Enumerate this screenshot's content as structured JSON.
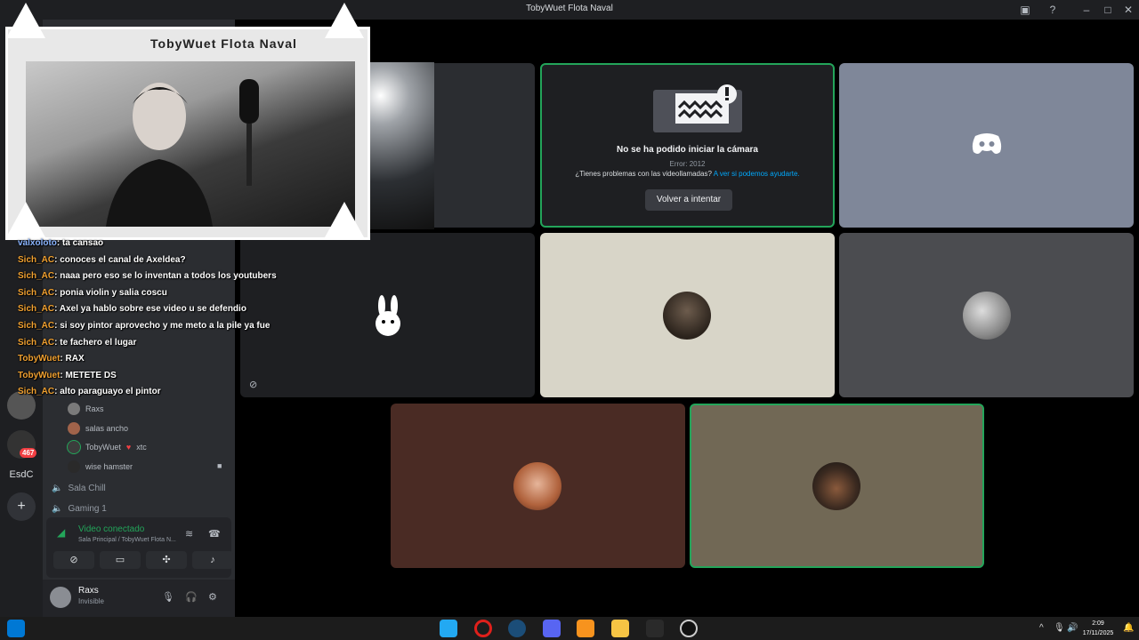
{
  "window": {
    "title": "TobyWuet Flota Naval"
  },
  "titlebar_icons": [
    "inbox-icon",
    "help-icon",
    "minimize-icon",
    "maximize-icon",
    "close-icon"
  ],
  "cam_overlay": {
    "title_text": "TobyWuet Flota Naval"
  },
  "chat": [
    {
      "nick": "valxoloto",
      "msg": ": ta cansao",
      "color": "blue"
    },
    {
      "nick": "Sich_AC",
      "msg": ": conoces el canal de Axeldea?",
      "color": "orange"
    },
    {
      "nick": "Sich_AC",
      "msg": ": naaa pero eso se lo inventan a todos los youtubers",
      "color": "orange"
    },
    {
      "nick": "Sich_AC",
      "msg": ": ponia violin y salia coscu",
      "color": "orange"
    },
    {
      "nick": "Sich_AC",
      "msg": ": Axel ya hablo sobre ese video u se defendio",
      "color": "orange"
    },
    {
      "nick": "Sich_AC",
      "msg": ": si soy pintor aprovecho y me meto a la pile ya fue",
      "color": "orange"
    },
    {
      "nick": "Sich_AC",
      "msg": ": te fachero el lugar",
      "color": "orange"
    },
    {
      "nick": "TobyWuet",
      "msg": ": RAX",
      "color": "orange"
    },
    {
      "nick": "TobyWuet",
      "msg": ": METETE DS",
      "color": "orange"
    },
    {
      "nick": "Sich_AC",
      "msg": ": alto paraguayo el pintor",
      "color": "orange"
    }
  ],
  "sidebar": {
    "members": [
      {
        "name": "Raxs",
        "extra": ""
      },
      {
        "name": "salas ancho",
        "extra": ""
      },
      {
        "name": "TobyWuet",
        "extra": "xtc"
      },
      {
        "name": "wise hamster",
        "extra": ""
      }
    ],
    "channels": [
      {
        "name": "Sala Chill"
      },
      {
        "name": "Gaming 1"
      }
    ],
    "server_label": "EsdC",
    "badge": "467"
  },
  "voice": {
    "status": "Video conectado",
    "location": "Sala Principal / TobyWuet Flota N..."
  },
  "user": {
    "name": "Raxs",
    "status": "Invisible"
  },
  "camera_error": {
    "title": "No se ha podido iniciar la cámara",
    "code": "Error: 2012",
    "help_text": "¿Tienes problemas con las videollamadas?",
    "help_link": "A ver si podemos ayudarte.",
    "retry": "Volver a intentar"
  },
  "tiles_colors": {
    "discord_tile": "#7f8799",
    "beige_tile": "#d8d5c8",
    "gray_tile": "#4b4c50",
    "brown_tile": "#4a2b24",
    "olive_tile": "#716855"
  },
  "taskbar": {
    "time": "2:09",
    "date": "17/11/2025",
    "apps": [
      "windows-start-icon",
      "vscode-icon",
      "opera-icon",
      "steam-icon",
      "discord-icon",
      "fl-studio-icon",
      "file-explorer-icon",
      "epic-games-icon",
      "obs-icon"
    ]
  }
}
